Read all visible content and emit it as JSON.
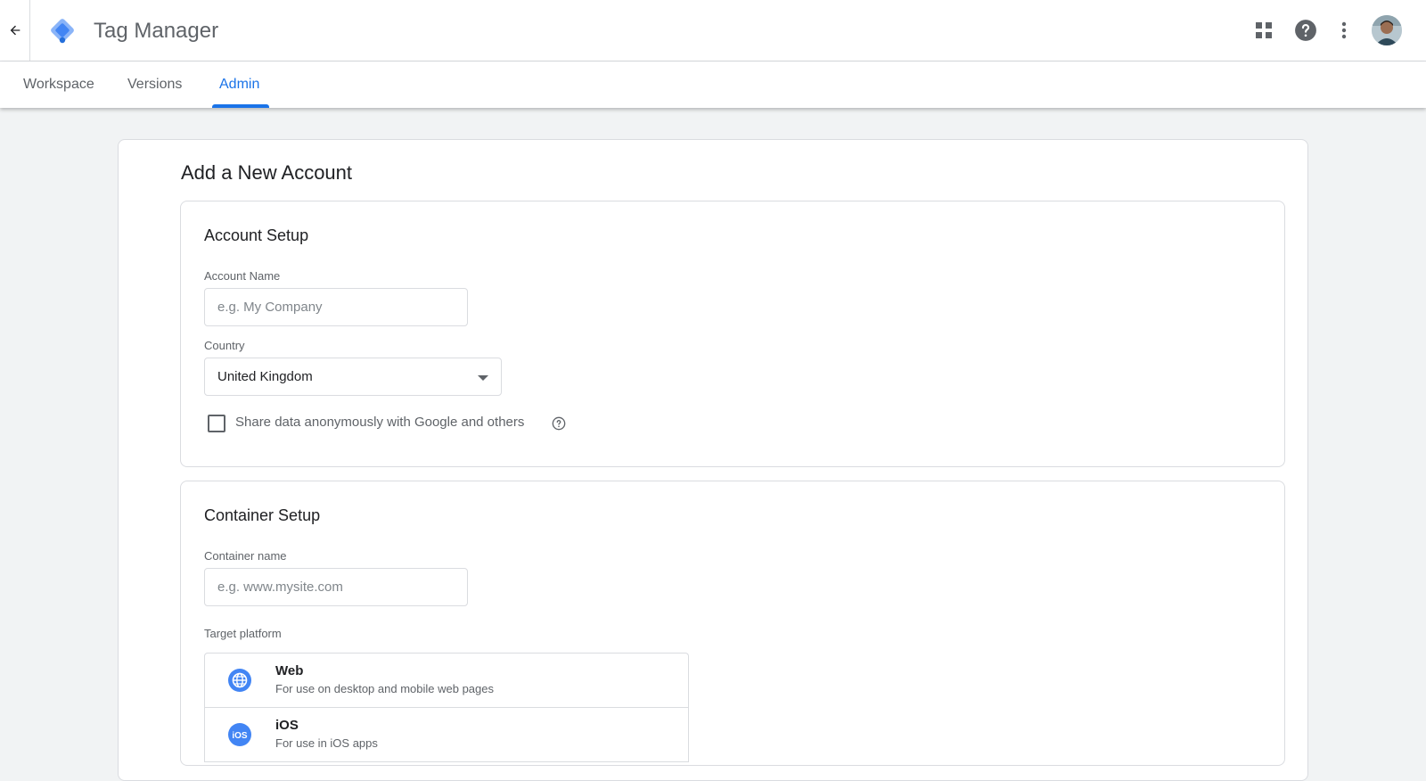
{
  "app": {
    "title": "Tag Manager"
  },
  "tabs": [
    {
      "label": "Workspace",
      "active": false
    },
    {
      "label": "Versions",
      "active": false
    },
    {
      "label": "Admin",
      "active": true
    }
  ],
  "colors": {
    "accent": "#1a73e8",
    "logo_blue": "#4285f4",
    "logo_dark": "#246fdb",
    "background": "#f1f3f4"
  },
  "icons": {
    "back": "arrow-left-icon",
    "apps": "apps-grid-icon",
    "help": "help-circle-icon",
    "more": "more-vert-icon"
  },
  "page": {
    "title": "Add a New Account"
  },
  "account_setup": {
    "title": "Account Setup",
    "account_name_label": "Account Name",
    "account_name_placeholder": "e.g. My Company",
    "account_name_value": "",
    "country_label": "Country",
    "country_value": "United Kingdom",
    "share_data_label": "Share data anonymously with Google and others",
    "share_data_checked": false
  },
  "container_setup": {
    "title": "Container Setup",
    "container_name_label": "Container name",
    "container_name_placeholder": "e.g. www.mysite.com",
    "container_name_value": "",
    "target_platform_label": "Target platform",
    "platforms": [
      {
        "name": "Web",
        "description": "For use on desktop and mobile web pages",
        "icon": "globe-icon"
      },
      {
        "name": "iOS",
        "description": "For use in iOS apps",
        "icon": "ios-icon"
      }
    ]
  }
}
